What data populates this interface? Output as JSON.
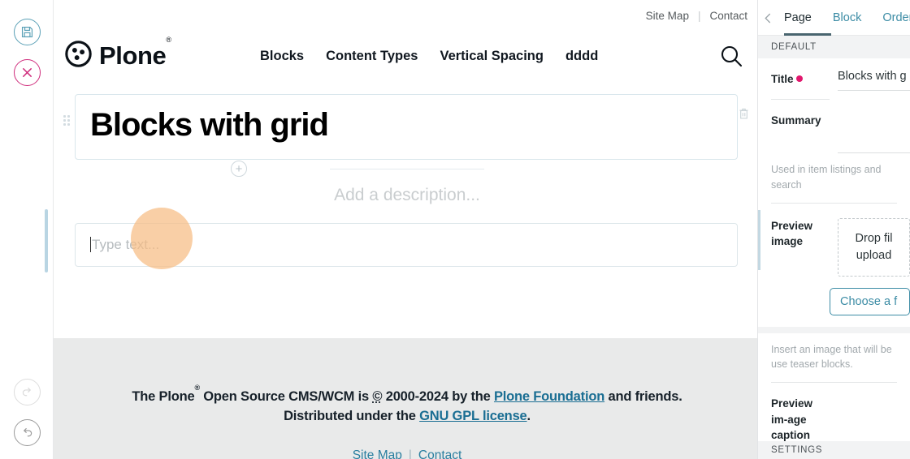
{
  "toolbar": {
    "save_label": "Save",
    "cancel_label": "Cancel",
    "redo_label": "Redo",
    "undo_label": "Undo"
  },
  "site": {
    "top_links": [
      {
        "label": "Site Map"
      },
      {
        "label": "Contact"
      }
    ],
    "logo_text": "Plone",
    "logo_mark": "®",
    "nav": [
      {
        "label": "Blocks"
      },
      {
        "label": "Content Types"
      },
      {
        "label": "Vertical Spacing"
      },
      {
        "label": "dddd"
      }
    ],
    "search_icon": "search-icon"
  },
  "editor": {
    "title_value": "Blocks with grid",
    "description_placeholder": "Add a description...",
    "text_block_placeholder": "Type text...",
    "add_block_label": "+",
    "delete_block_label": "Delete block",
    "drag_handle_label": "Drag block"
  },
  "footer": {
    "line1_a": "The Plone",
    "line1_sup": "®",
    "line1_b": " Open Source CMS/WCM is ",
    "copyright_mark": "©",
    "line1_c": " 2000-2024 by the ",
    "foundation_link": "Plone Foundation",
    "line1_d": " and friends.",
    "line2_a": "Distributed under the ",
    "license_link": "GNU GPL license",
    "line2_b": ".",
    "links": [
      {
        "label": "Site Map"
      },
      {
        "label": "Contact"
      }
    ]
  },
  "sidebar": {
    "back_label": "Back",
    "tabs": [
      {
        "label": "Page",
        "active": true
      },
      {
        "label": "Block",
        "active": false
      },
      {
        "label": "Order",
        "active": false
      }
    ],
    "section_default": "DEFAULT",
    "fields": {
      "title_label": "Title",
      "title_value": "Blocks with g",
      "summary_label": "Summary",
      "summary_value": "",
      "summary_help": "Used in item listings and search",
      "preview_image_label": "Preview image",
      "dropzone_text": "Drop fil upload",
      "choose_file_label": "Choose a f",
      "preview_help": "Insert an image that will be use teaser blocks.",
      "caption_label": "Preview im-age caption",
      "caption_value": ""
    },
    "section_settings": "SETTINGS"
  },
  "colors": {
    "save_accent": "#5aa0b6",
    "cancel_accent": "#cf2d7c",
    "required_dot": "#e1176d",
    "link_teal": "#3c8ca5",
    "footer_link": "#1a6e93",
    "cursor_halo": "#f7bc84"
  }
}
